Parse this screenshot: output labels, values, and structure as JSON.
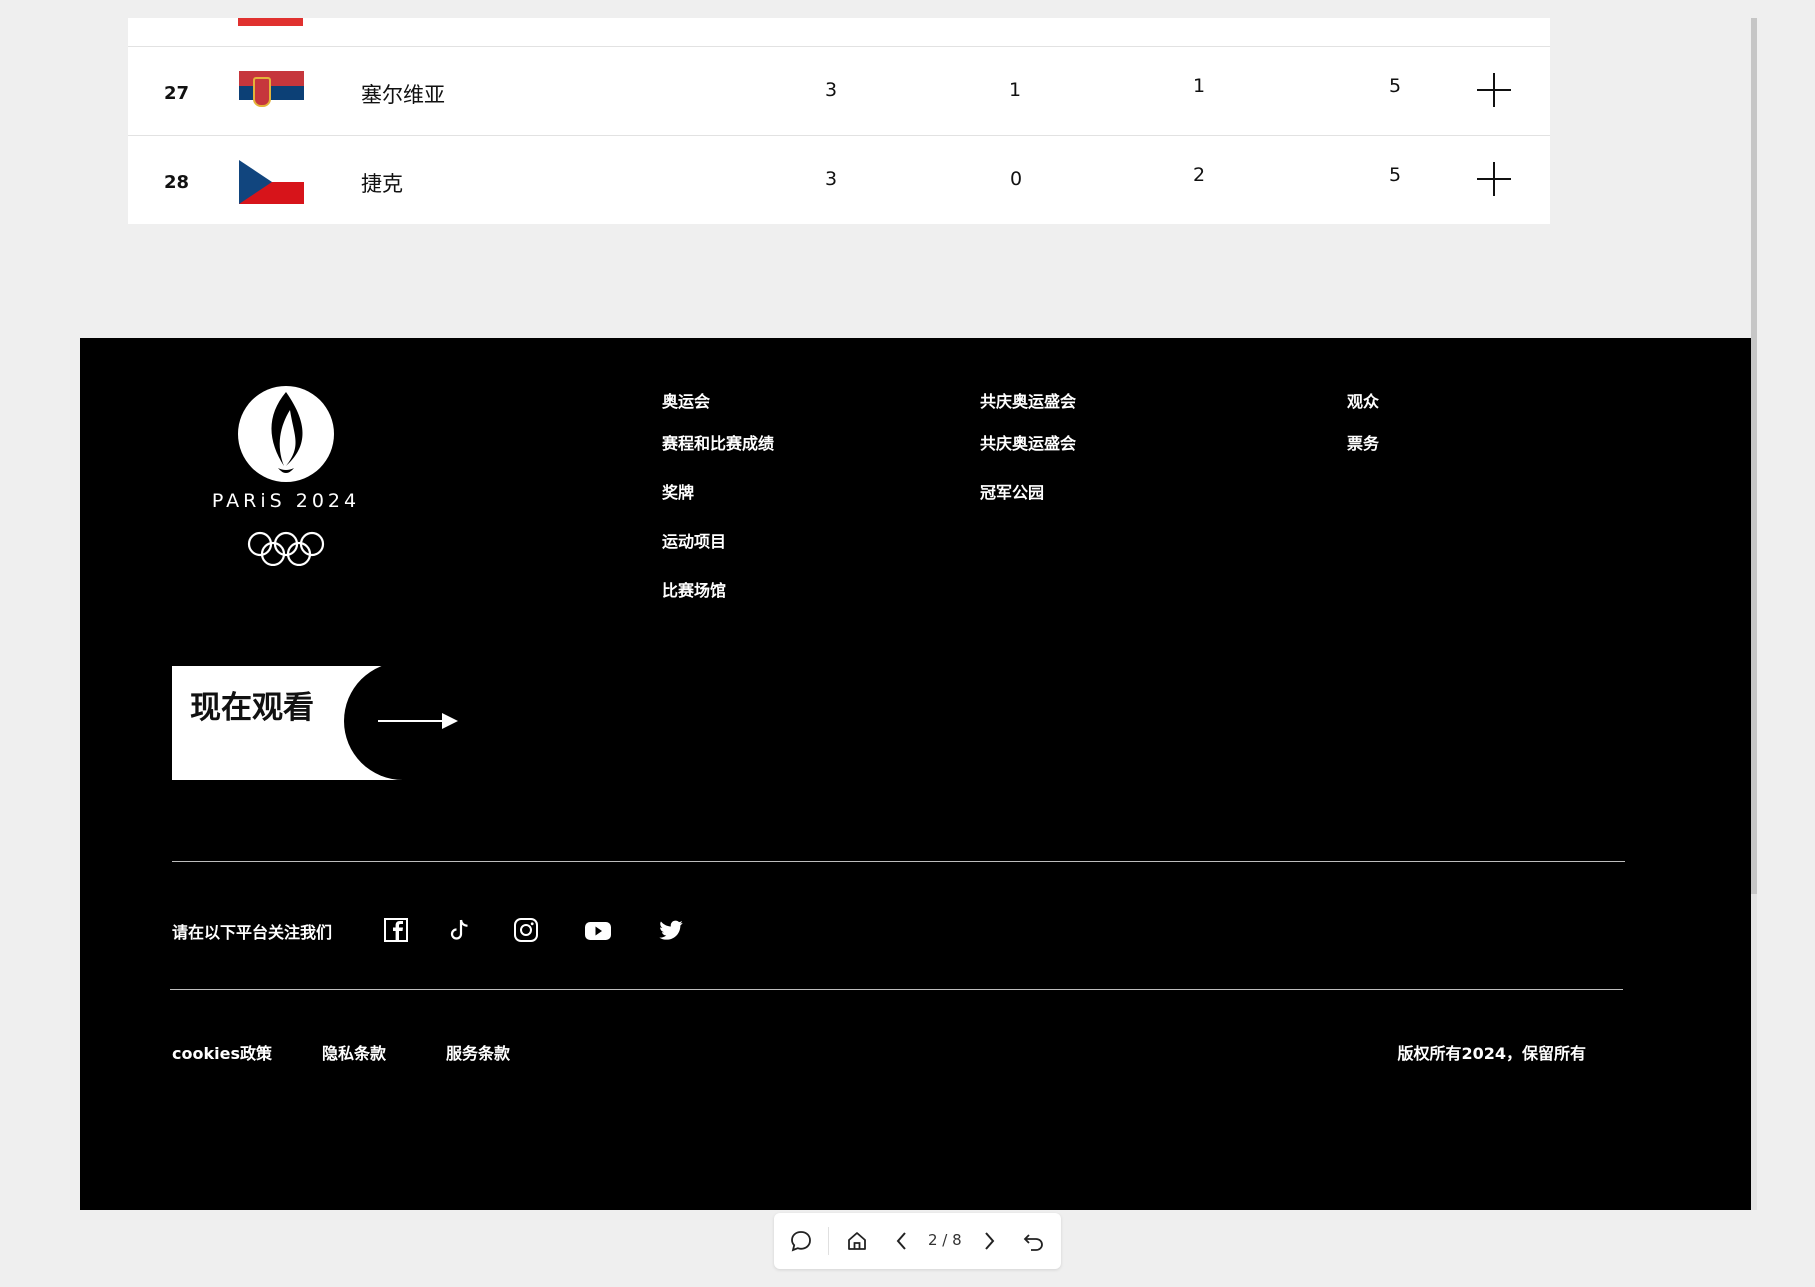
{
  "medal_table": {
    "rows": [
      {
        "rank": "27",
        "country": "塞尔维亚",
        "gold": "3",
        "silver": "1",
        "bronze": "1",
        "total": "5"
      },
      {
        "rank": "28",
        "country": "捷克",
        "gold": "3",
        "silver": "0",
        "bronze": "2",
        "total": "5"
      }
    ]
  },
  "footer": {
    "logo_text": "PARiS 2024",
    "nav": [
      {
        "head": "奥运会",
        "links": [
          "赛程和比赛成绩",
          "奖牌",
          "运动项目",
          "比赛场馆"
        ]
      },
      {
        "head": "共庆奥运盛会",
        "links": [
          "共庆奥运盛会",
          "冠军公园"
        ]
      },
      {
        "head": "观众",
        "links": [
          "票务"
        ]
      }
    ],
    "watch_now": "现在观看",
    "follow_label": "请在以下平台关注我们",
    "social_icons": [
      "facebook-icon",
      "tiktok-icon",
      "instagram-icon",
      "youtube-icon",
      "twitter-icon"
    ],
    "legal": [
      "cookies政策",
      "隐私条款",
      "服务条款"
    ],
    "copyright": "版权所有2024，保留所有"
  },
  "toolbar": {
    "page_indicator": "2 / 8"
  }
}
